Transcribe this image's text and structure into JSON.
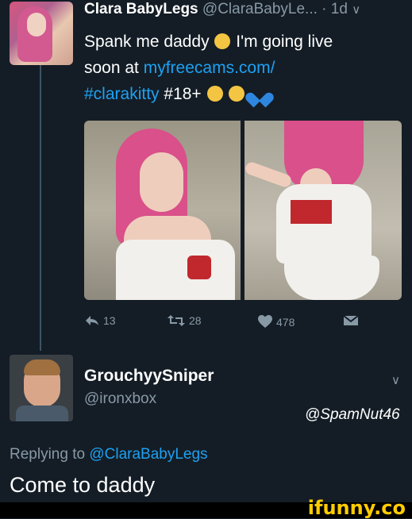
{
  "tweet1": {
    "display_name": "Clara BabyLegs",
    "handle": "@ClaraBabyLe...",
    "separator": "·",
    "time": "1d",
    "body_line1_text": "Spank me daddy",
    "body_line1_after": "I'm going live",
    "body_line2_prefix": "soon at",
    "link": "myfreecams.com/",
    "hashtag": "#clarakitty",
    "tag_18": "#18+",
    "emojis": [
      "weary-face",
      "smiling-face",
      "kissing-face",
      "blue-heart"
    ],
    "actions": {
      "reply_count": "13",
      "retweet_count": "28",
      "like_count": "478"
    }
  },
  "tweet2": {
    "display_name": "GrouchyySniper",
    "handle": "@ironxbox",
    "replying_prefix": "Replying to",
    "replying_handle": "@ClaraBabyLegs",
    "text": "Come to daddy"
  },
  "credit": "@SpamNut46",
  "watermark": "ifunny.co",
  "colors": {
    "background": "#141d26",
    "link": "#1da1f2",
    "muted": "#8899a6",
    "watermark": "#ffcc00"
  }
}
